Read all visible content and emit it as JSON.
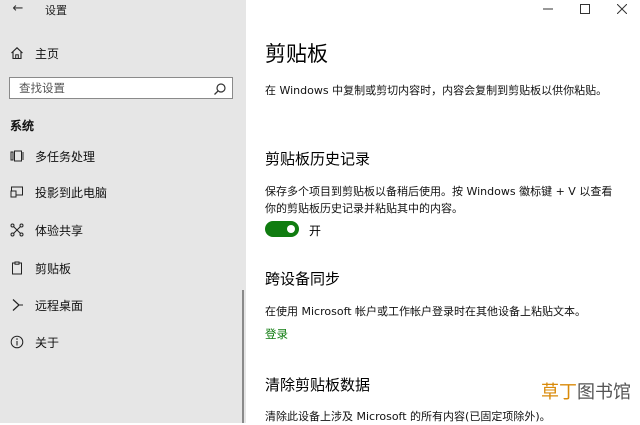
{
  "window": {
    "app_title": "设置",
    "back_glyph": "←"
  },
  "sidebar": {
    "home_label": "主页",
    "search_placeholder": "查找设置",
    "section_label": "系统",
    "items": [
      {
        "label": "多任务处理",
        "icon": "multitask-icon"
      },
      {
        "label": "投影到此电脑",
        "icon": "project-icon"
      },
      {
        "label": "体验共享",
        "icon": "share-icon"
      },
      {
        "label": "剪贴板",
        "icon": "clipboard-icon",
        "active": true
      },
      {
        "label": "远程桌面",
        "icon": "remote-desktop-icon"
      },
      {
        "label": "关于",
        "icon": "info-icon"
      }
    ]
  },
  "main": {
    "title": "剪贴板",
    "intro": "在 Windows 中复制或剪切内容时，内容会复制到剪贴板以供你粘贴。",
    "history": {
      "heading": "剪贴板历史记录",
      "desc": "保存多个项目到剪贴板以备稍后使用。按 Windows 徽标键 + V 以查看你的剪贴板历史记录并粘贴其中的内容。",
      "toggle_label": "开",
      "toggle_on": true
    },
    "sync": {
      "heading": "跨设备同步",
      "desc": "在使用 Microsoft 帐户或工作帐户登录时在其他设备上粘贴文本。",
      "link": "登录"
    },
    "clear": {
      "heading": "清除剪贴板数据",
      "desc": "清除此设备上涉及 Microsoft 的所有内容(已固定项除外)。"
    }
  },
  "watermark": {
    "part1": "草丁",
    "part2": "图书馆"
  },
  "colors": {
    "accent_green": "#107c10",
    "sidebar_bg": "#e6e6e6"
  }
}
